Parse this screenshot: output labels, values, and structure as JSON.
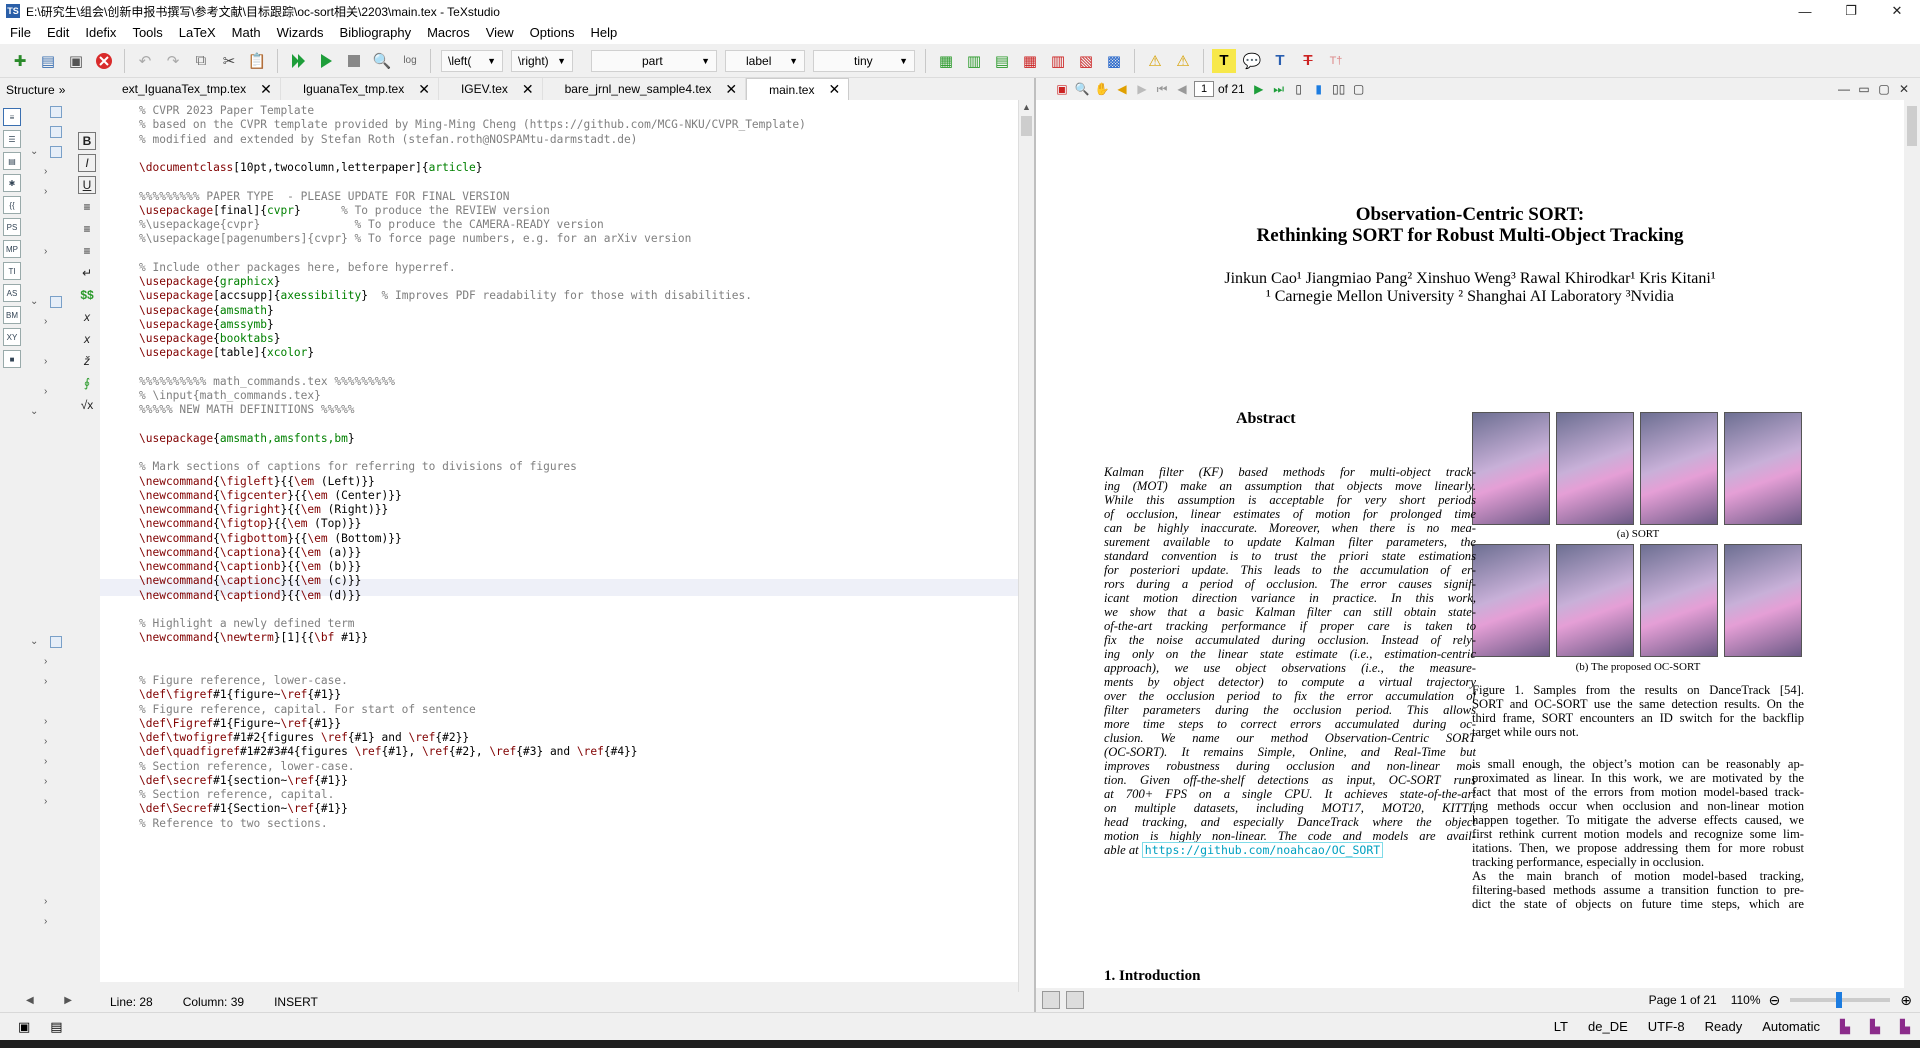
{
  "window": {
    "title": "E:\\研究生\\组会\\创新申报书撰写\\参考文献\\目标跟踪\\oc-sort相关\\2203\\main.tex - TeXstudio",
    "app_icon_text": "TS",
    "minimize": "—",
    "maximize": "❐",
    "close": "✕"
  },
  "menu": [
    "File",
    "Edit",
    "Idefix",
    "Tools",
    "LaTeX",
    "Math",
    "Wizards",
    "Bibliography",
    "Macros",
    "View",
    "Options",
    "Help"
  ],
  "toolbar": {
    "combo_left": "\\left(",
    "combo_right": "\\right)",
    "combo_part": "part",
    "combo_label": "label",
    "combo_size": "tiny"
  },
  "structure": {
    "header": "Structure",
    "more": "»"
  },
  "tabs": [
    {
      "label": "ext_IguanaTex_tmp.tex"
    },
    {
      "label": "IguanaTex_tmp.tex"
    },
    {
      "label": "IGEV.tex"
    },
    {
      "label": "bare_jrnl_new_sample4.tex"
    },
    {
      "label": "main.tex"
    }
  ],
  "editor_lines": [
    "% CVPR 2023 Paper Template",
    "% based on the CVPR template provided by Ming-Ming Cheng (https://github.com/MCG-NKU/CVPR_Template)",
    "% modified and extended by Stefan Roth (stefan.roth@NOSPAMtu-darmstadt.de)",
    "",
    "\\documentclass[10pt,twocolumn,letterpaper]{article}",
    "",
    "%%%%%%%%% PAPER TYPE  - PLEASE UPDATE FOR FINAL VERSION",
    "\\usepackage[final]{cvpr}      % To produce the REVIEW version",
    "%\\usepackage{cvpr}              % To produce the CAMERA-READY version",
    "%\\usepackage[pagenumbers]{cvpr} % To force page numbers, e.g. for an arXiv version",
    "",
    "% Include other packages here, before hyperref.",
    "\\usepackage{graphicx}",
    "\\usepackage[accsupp]{axessibility}  % Improves PDF readability for those with disabilities.",
    "\\usepackage{amsmath}",
    "\\usepackage{amssymb}",
    "\\usepackage{booktabs}",
    "\\usepackage[table]{xcolor}",
    "",
    "%%%%%%%%%% math_commands.tex %%%%%%%%%",
    "% \\input{math_commands.tex}",
    "%%%%% NEW MATH DEFINITIONS %%%%%",
    "",
    "\\usepackage{amsmath,amsfonts,bm}",
    "",
    "% Mark sections of captions for referring to divisions of figures",
    "\\newcommand{\\figleft}{{\\em (Left)}}",
    "\\newcommand{\\figcenter}{{\\em (Center)}}",
    "\\newcommand{\\figright}{{\\em (Right)}}",
    "\\newcommand{\\figtop}{{\\em (Top)}}",
    "\\newcommand{\\figbottom}{{\\em (Bottom)}}",
    "\\newcommand{\\captiona}{{\\em (a)}}",
    "\\newcommand{\\captionb}{{\\em (b)}}",
    "\\newcommand{\\captionc}{{\\em (c)}}",
    "\\newcommand{\\captiond}{{\\em (d)}}",
    "",
    "% Highlight a newly defined term",
    "\\newcommand{\\newterm}[1]{{\\bf #1}}",
    "",
    "",
    "% Figure reference, lower-case.",
    "\\def\\figref#1{figure~\\ref{#1}}",
    "% Figure reference, capital. For start of sentence",
    "\\def\\Figref#1{Figure~\\ref{#1}}",
    "\\def\\twofigref#1#2{figures \\ref{#1} and \\ref{#2}}",
    "\\def\\quadfigref#1#2#3#4{figures \\ref{#1}, \\ref{#2}, \\ref{#3} and \\ref{#4}}",
    "% Section reference, lower-case.",
    "\\def\\secref#1{section~\\ref{#1}}",
    "% Section reference, capital.",
    "\\def\\Secref#1{Section~\\ref{#1}}",
    "% Reference to two sections."
  ],
  "editor_status": {
    "line": "Line: 28",
    "column": "Column: 39",
    "mode": "INSERT"
  },
  "pdf_toolbar": {
    "page_value": "1",
    "page_total": "of 21"
  },
  "pdf": {
    "title_line1": "Observation-Centric SORT:",
    "title_line2": "Rethinking SORT for Robust Multi-Object Tracking",
    "authors": "Jinkun Cao¹    Jiangmiao Pang²    Xinshuo Weng³    Rawal Khirodkar¹    Kris Kitani¹",
    "affiliations": "¹ Carnegie Mellon University    ² Shanghai AI Laboratory    ³Nvidia",
    "abstract_heading": "Abstract",
    "abstract_lines": [
      "Kalman filter (KF) based methods for multi-object track-",
      "ing (MOT) make an assumption that objects move linearly.",
      "While this assumption is acceptable for very short periods",
      "of occlusion, linear estimates of motion for prolonged time",
      "can be highly inaccurate. Moreover, when there is no mea-",
      "surement available to update Kalman filter parameters, the",
      "standard convention is to trust the priori state estimations",
      "for posteriori update. This leads to the accumulation of er-",
      "rors during a period of occlusion. The error causes signif-",
      "icant motion direction variance in practice. In this work,",
      "we show that a basic Kalman filter can still obtain state-",
      "of-the-art tracking performance if proper care is taken to",
      "fix the noise accumulated during occlusion. Instead of rely-",
      "ing only on the linear state estimate (i.e., estimation-centric",
      "approach), we use object observations (i.e., the measure-",
      "ments by object detector) to compute a virtual trajectory",
      "over the occlusion period to fix the error accumulation of",
      "filter parameters during the occlusion period. This allows",
      "more time steps to correct errors accumulated during oc-",
      "clusion. We name our method Observation-Centric SORT",
      "(OC-SORT). It remains Simple, Online, and Real-Time but",
      "improves robustness during occlusion and non-linear mo-",
      "tion. Given off-the-shelf detections as input, OC-SORT runs",
      "at 700+ FPS on a single CPU. It achieves state-of-the-art",
      "on multiple datasets, including MOT17, MOT20, KITTI,",
      "head tracking, and especially DanceTrack where the object",
      "motion is highly non-linear. The code and models are avail-"
    ],
    "abstract_last_prefix": "able at ",
    "abstract_link": "https://github.com/noahcao/OC_SORT",
    "sub_a": "(a) SORT",
    "sub_b": "(b) The proposed OC-SORT",
    "fig_caption_lines": [
      "Figure 1.  Samples from the results on DanceTrack [54].",
      "SORT and OC-SORT use the same detection results. On the",
      "third frame, SORT encounters an ID switch for the backflip",
      "target while ours not."
    ],
    "body_lines": [
      "is small enough, the object’s motion can be reasonably ap-",
      "proximated as linear. In this work, we are motivated by the",
      "fact that most of the errors from motion model-based track-",
      "ing methods occur when occlusion and non-linear motion",
      "happen together. To mitigate the adverse effects caused, we",
      "first rethink current motion models and recognize some lim-",
      "itations. Then, we propose addressing them for more robust",
      "tracking performance, especially in occlusion.",
      "    As the main branch of motion model-based tracking,",
      "filtering-based methods assume a transition function to pre-",
      "dict the state of objects on future time steps, which are"
    ],
    "intro_heading": "1. Introduction"
  },
  "pdf_status": {
    "page": "Page 1 of 21",
    "zoom": "110%"
  },
  "statusbar": {
    "language": "de_DE",
    "encoding": "UTF-8",
    "state": "Ready",
    "mode": "Automatic"
  }
}
